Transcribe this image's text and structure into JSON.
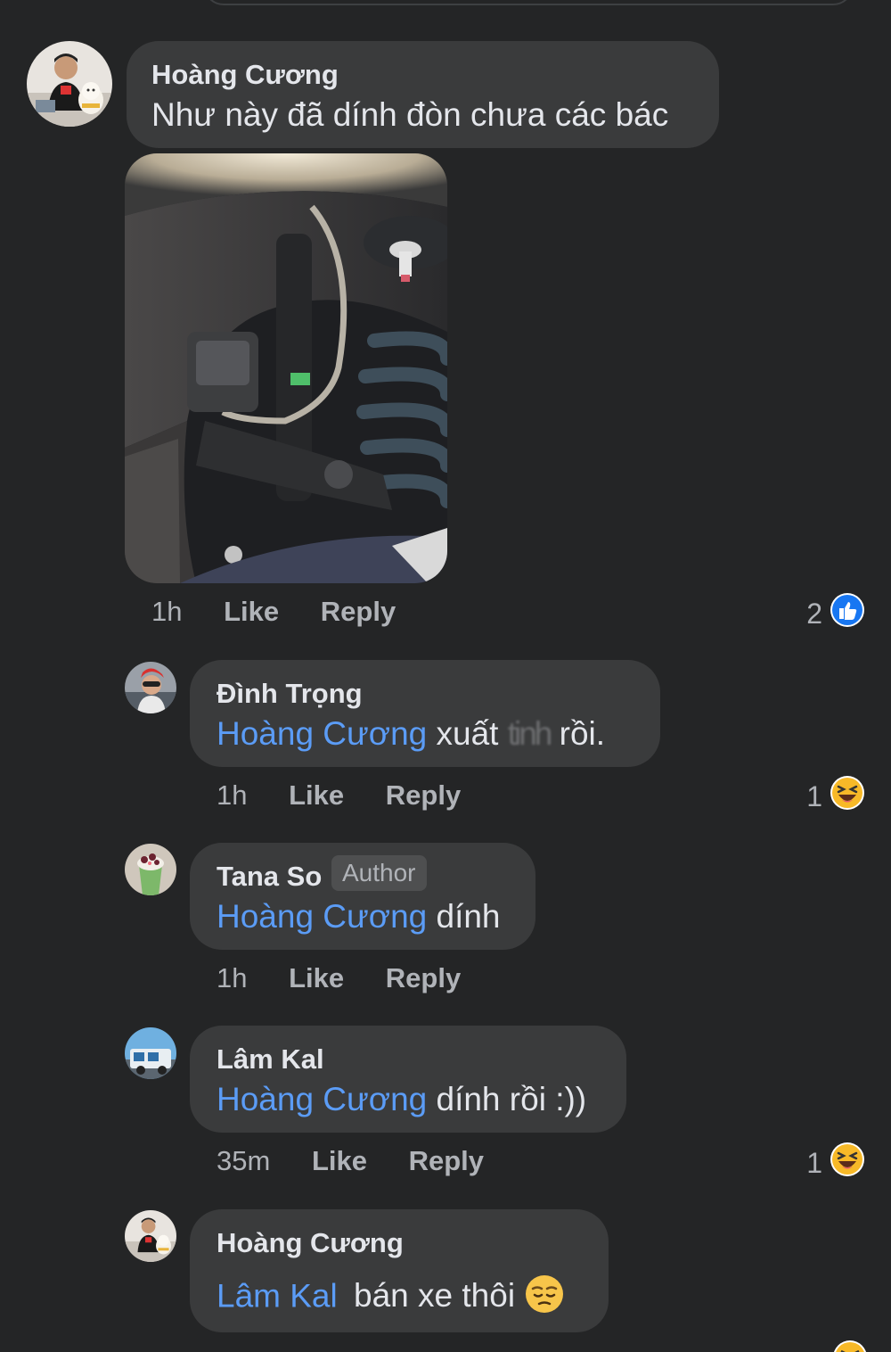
{
  "comments": [
    {
      "author": "Hoàng Cương",
      "text": "Như này đã dính đòn chưa các bác",
      "time": "1h",
      "like": "Like",
      "reply": "Reply",
      "reaction_count": "2",
      "reaction": "like-reaction-icon"
    },
    {
      "author": "Đình Trọng",
      "mention": "Hoàng Cương",
      "text_before": "xuất",
      "text_obscured": "tinh",
      "text_after": "rồi.",
      "time": "1h",
      "like": "Like",
      "reply": "Reply",
      "reaction_count": "1",
      "reaction": "laughing-reaction-icon"
    },
    {
      "author": "Tana So",
      "badge": "Author",
      "mention": "Hoàng Cương",
      "text": "dính",
      "time": "1h",
      "like": "Like",
      "reply": "Reply"
    },
    {
      "author": "Lâm Kal",
      "mention": "Hoàng Cương",
      "text": "dính rồi :))",
      "time": "35m",
      "like": "Like",
      "reply": "Reply",
      "reaction_count": "1",
      "reaction": "laughing-reaction-icon"
    },
    {
      "author": "Hoàng Cương",
      "mention": "Lâm Kal",
      "text": "bán xe thôi",
      "emoji": "pensive-face-icon"
    }
  ],
  "colors": {
    "background": "#242526",
    "bubble": "#3a3b3c",
    "mention": "#5b9cf6",
    "meta": "#b0b3b8",
    "like_blue": "#1877f2",
    "haha_yellow": "#f7b928"
  }
}
